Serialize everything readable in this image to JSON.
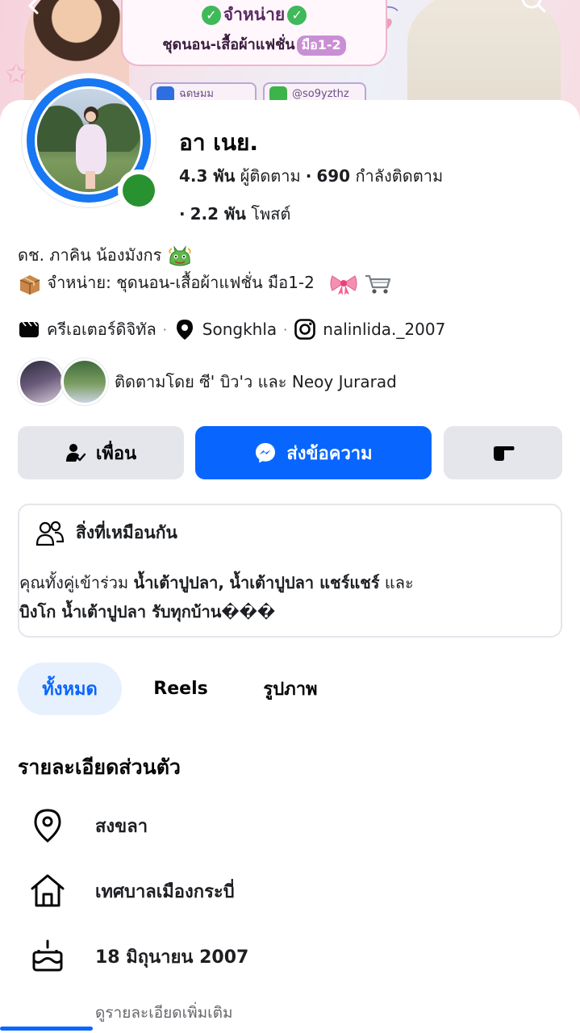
{
  "cover": {
    "title": "จำหน่าย",
    "subtitle": "ชุดนอน-เสื้อผ้าแฟชั่น",
    "tag": "มือ1-2",
    "chip_left": "ฉดษมม",
    "chip_right": "@so9yzthz"
  },
  "profile": {
    "name": "อา เนย.",
    "followers_count": "4.3 พัน",
    "followers_label": "ผู้ติดตาม",
    "following_count": "690",
    "following_label": "กำลังติดตาม",
    "posts_count": "2.2 พัน",
    "posts_label": "โพสต์",
    "bio_line1": "ดช. ภาคิน น้องมังกร",
    "bio_line2": "จำหน่าย: ชุดนอน-เสื้อผ้าแฟชั่น มือ1-2"
  },
  "meta": {
    "category": "ครีเอเตอร์ดิจิทัล",
    "location": "Songkhla",
    "instagram": "nalinlida._2007"
  },
  "followed_by": {
    "text": "ติดตามโดย ซี' บิว'ว และ Neoy Jurarad"
  },
  "actions": {
    "friend_label": "เพื่อน",
    "message_label": "ส่งข้อความ"
  },
  "common": {
    "title": "สิ่งที่เหมือนกัน",
    "line1_prefix": "คุณทั้งคู่เข้าร่วม",
    "line1_group1": "น้ำเต้าปูปลา,",
    "line1_group2": "น้ำเต้าปูปลา แชร์แชร์",
    "line1_and": "และ",
    "line2_group3": "บิงโก น้ำเต้าปูปลา รับทุกบ้าน���"
  },
  "tabs": {
    "all": "ทั้งหมด",
    "reels": "Reels",
    "photos": "รูปภาพ"
  },
  "details": {
    "title": "รายละเอียดส่วนตัว",
    "current_city": "สงขลา",
    "hometown": "เทศบาลเมืองกระบี่",
    "birthday": "18 มิถุนายน  2007",
    "see_more": "ดูรายละเอียดเพิ่มเติม"
  },
  "colors": {
    "primary_blue": "#0866ff",
    "button_gray": "#e4e6eb",
    "online_green": "#27922f",
    "tab_active_bg": "#e7f0fd"
  },
  "icons": {
    "back": "back-arrow-icon",
    "search": "search-icon",
    "category": "clapperboard-icon",
    "location": "location-pin-icon",
    "instagram": "instagram-icon",
    "friend": "person-check-icon",
    "message": "messenger-icon",
    "poke": "poke-icon",
    "common": "people-icon",
    "city": "map-pin-icon",
    "hometown": "home-icon",
    "birthday": "cake-icon"
  }
}
